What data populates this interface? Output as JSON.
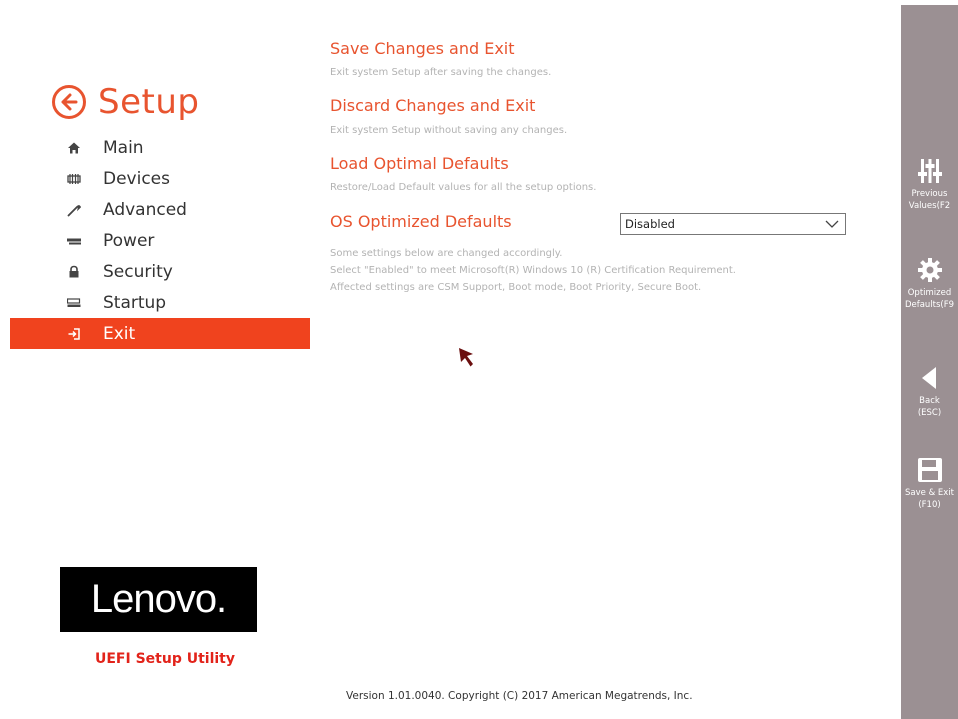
{
  "brand": {
    "title": "Setup"
  },
  "nav": {
    "items": [
      {
        "label": "Main",
        "icon": "home-icon"
      },
      {
        "label": "Devices",
        "icon": "devices-icon"
      },
      {
        "label": "Advanced",
        "icon": "wrench-icon"
      },
      {
        "label": "Power",
        "icon": "power-icon"
      },
      {
        "label": "Security",
        "icon": "lock-icon"
      },
      {
        "label": "Startup",
        "icon": "startup-icon"
      },
      {
        "label": "Exit",
        "icon": "exit-icon",
        "active": true
      }
    ]
  },
  "options": [
    {
      "title": "Save Changes and Exit",
      "desc": "Exit system Setup after saving the changes."
    },
    {
      "title": "Discard Changes and Exit",
      "desc": "Exit system Setup without saving any changes."
    },
    {
      "title": "Load Optimal Defaults",
      "desc": "Restore/Load Default values for all the setup options."
    },
    {
      "title": "OS Optimized Defaults",
      "value": "Disabled"
    }
  ],
  "note": {
    "lines": [
      "Some settings below are changed accordingly.",
      "Select \"Enabled\" to meet Microsoft(R) Windows 10 (R) Certification Requirement.",
      "Affected settings are CSM Support, Boot mode, Boot Priority, Secure Boot."
    ]
  },
  "logo": {
    "text": "Lenovo.",
    "subtitle": "UEFI Setup Utility"
  },
  "footer": {
    "version": "Version 1.01.0040. Copyright (C) 2017 American Megatrends, Inc."
  },
  "sidebar": {
    "items": [
      {
        "line1": "Previous",
        "line2": "Values(F2",
        "icon": "sliders-icon"
      },
      {
        "line1": "Optimized",
        "line2": "Defaults(F9",
        "icon": "gear-icon"
      },
      {
        "line1": "Back",
        "line2": "(ESC)",
        "icon": "back-arrow-icon"
      },
      {
        "line1": "Save & Exit",
        "line2": "(F10)",
        "icon": "save-icon"
      }
    ]
  },
  "colors": {
    "accent": "#e8542f",
    "active_bg": "#f0431e",
    "sidebar_bg": "#9b9093"
  }
}
